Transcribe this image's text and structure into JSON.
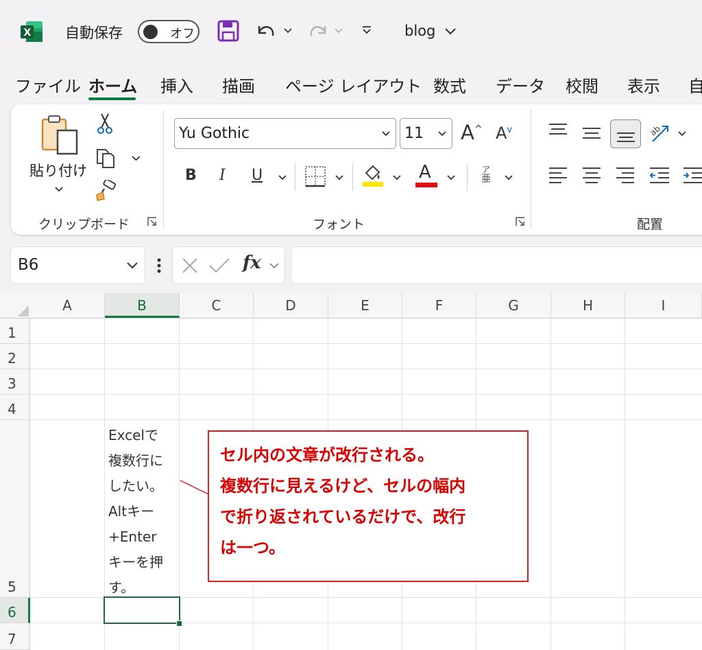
{
  "titlebar": {
    "autosave_label": "自動保存",
    "autosave_state": "オフ",
    "doc_name": "blog"
  },
  "ribbon_tabs": [
    "ファイル",
    "ホーム",
    "挿入",
    "描画",
    "ページ レイアウト",
    "数式",
    "データ",
    "校閲",
    "表示",
    "自"
  ],
  "clipboard": {
    "paste_label": "貼り付け",
    "group_label": "クリップボード"
  },
  "font": {
    "name": "Yu Gothic",
    "size": "11",
    "grow_label": "A",
    "shrink_label": "A",
    "bold": "B",
    "italic": "I",
    "underline": "U",
    "font_color_glyph": "A",
    "phonetic_top": "ア",
    "phonetic_bottom": "亜",
    "group_label": "フォント",
    "highlight_color": "#ffd900",
    "font_color": "#e01010"
  },
  "alignment": {
    "group_label": "配置"
  },
  "formula_bar": {
    "name_box": "B6",
    "fx_label": "fx",
    "content": ""
  },
  "sheet": {
    "columns": [
      "A",
      "B",
      "C",
      "D",
      "E",
      "F",
      "G",
      "H",
      "I"
    ],
    "selected_column": "B",
    "rows": [
      "1",
      "2",
      "3",
      "4",
      "5",
      "6",
      "7"
    ],
    "selected_row": "6",
    "cell_b5_lines": [
      "Excelで",
      "複数行に",
      "したい。",
      "Altキー",
      "+Enter",
      "キーを押",
      "す。"
    ]
  },
  "callout": {
    "lines": [
      "セル内の文章が改行される。",
      "複数行に見えるけど、セルの幅内",
      "で折り返されているだけで、改行",
      "は一つ。"
    ],
    "color": "#d90000"
  }
}
